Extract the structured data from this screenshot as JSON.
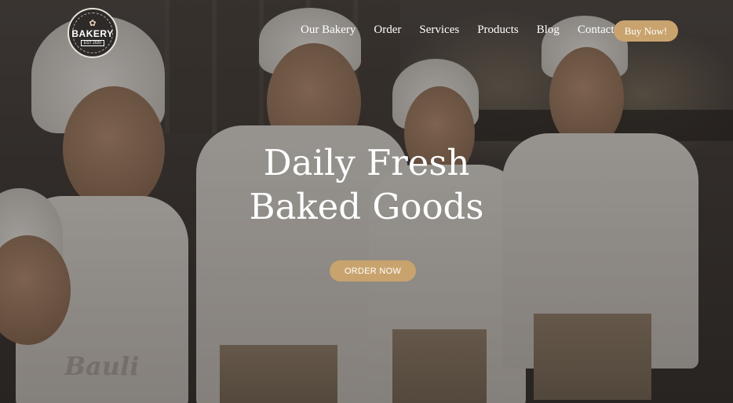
{
  "logo": {
    "icon": "pretzel-icon",
    "text": "BAKERY",
    "est": "EST 2020"
  },
  "nav": {
    "items": [
      "Our Bakery",
      "Order",
      "Services",
      "Products",
      "Blog",
      "Contact"
    ],
    "cta_label": "Buy Now!"
  },
  "hero": {
    "title_line1": "Daily Fresh",
    "title_line2": "Baked Goods",
    "button_label": "ORDER NOW",
    "image_brand_text": "Bauli"
  },
  "colors": {
    "accent": "#c9a36e",
    "text": "#ffffff",
    "overlay": "#2a2623"
  }
}
